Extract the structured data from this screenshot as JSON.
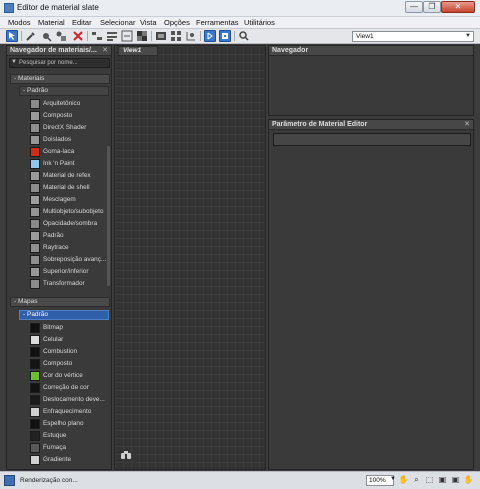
{
  "window": {
    "title": "Editor de material slate",
    "min": "—",
    "max": "❐",
    "close": "✕"
  },
  "menu": [
    "Modos",
    "Material",
    "Editar",
    "Selecionar",
    "Vista",
    "Opções",
    "Ferramentas",
    "Utilitários"
  ],
  "toolbar": {
    "icons": [
      "select-arrow-icon",
      "eyedropper-icon",
      "pick-material-icon",
      "assign-material-icon",
      "delete-icon",
      "layout-children-icon",
      "layout-all-icon",
      "hide-unused-icon",
      "map-display-icon",
      "background-icon",
      "preview-icon",
      "select-by-material-icon",
      "show-end-result-icon",
      "mtl-map-nav-icon"
    ],
    "view_select": "View1"
  },
  "browser": {
    "title": "Navegador de materiais/...",
    "search_placeholder": "Pesquisar por nome...",
    "materials_header": "Materiais",
    "materials_sub": "Padrão",
    "materials": [
      {
        "label": "Arquitetônico",
        "color": "#8a8a8a"
      },
      {
        "label": "Composto",
        "color": "#9a9a9a"
      },
      {
        "label": "DirectX Shader",
        "color": "#8f8f8f"
      },
      {
        "label": "Doislados",
        "color": "#969696"
      },
      {
        "label": "Goma-laca",
        "color": "#d42a1a"
      },
      {
        "label": "Ink 'n Paint",
        "color": "#8fc7e8"
      },
      {
        "label": "Material de refex",
        "color": "#9a9a9a"
      },
      {
        "label": "Material de shell",
        "color": "#8c8c8c"
      },
      {
        "label": "Mesclagem",
        "color": "#9e9e9e"
      },
      {
        "label": "Multiobjeto/subobjeto",
        "color": "#949494"
      },
      {
        "label": "Opacidade/sombra",
        "color": "#888888"
      },
      {
        "label": "Padrão",
        "color": "#9a9a9a"
      },
      {
        "label": "Raytrace",
        "color": "#909090"
      },
      {
        "label": "Sobreposição avanç...",
        "color": "#8e8e8e"
      },
      {
        "label": "Superior/inferior",
        "color": "#989898"
      },
      {
        "label": "Transformador",
        "color": "#8c8c8c"
      }
    ],
    "maps_header": "Mapas",
    "maps_sub": "Padrão",
    "maps": [
      {
        "label": "Bitmap",
        "color": "#111111"
      },
      {
        "label": "Celular",
        "color": "#dcdcdc"
      },
      {
        "label": "Combustion",
        "color": "#111111"
      },
      {
        "label": "Composto",
        "color": "#151515"
      },
      {
        "label": "Cor do vértice",
        "color": "#6fbf2a"
      },
      {
        "label": "Correção de cor",
        "color": "#111111"
      },
      {
        "label": "Deslocamento deve...",
        "color": "#1a1a1a"
      },
      {
        "label": "Enfraquecimento",
        "color": "#cfcfcf"
      },
      {
        "label": "Espelho plano",
        "color": "#111111"
      },
      {
        "label": "Estuque",
        "color": "#222222"
      },
      {
        "label": "Fumaça",
        "color": "#5a5a5a"
      },
      {
        "label": "Gradiente",
        "color": "#d0d0d0"
      }
    ]
  },
  "view": {
    "tab": "View1"
  },
  "navigator": {
    "title": "Navegador"
  },
  "params": {
    "title": "Parâmetro de Material Editor"
  },
  "status": {
    "text": "Renderização con...",
    "zoom": "100%"
  }
}
